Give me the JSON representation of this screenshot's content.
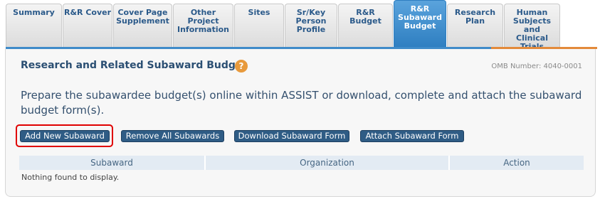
{
  "tabs": [
    {
      "label": "Summary",
      "active": false
    },
    {
      "label": "R&R Cover",
      "active": false
    },
    {
      "label": "Cover Page\nSupplement",
      "active": false
    },
    {
      "label": "Other\nProject\nInformation",
      "active": false
    },
    {
      "label": "Sites",
      "active": false
    },
    {
      "label": "Sr/Key\nPerson\nProfile",
      "active": false
    },
    {
      "label": "R&R Budget",
      "active": false
    },
    {
      "label": "R&R\nSubaward\nBudget",
      "active": true
    },
    {
      "label": "Research\nPlan",
      "active": false
    },
    {
      "label": "Human\nSubjects and\nClinical Trials",
      "active": false
    }
  ],
  "page": {
    "title": "Research and Related Subaward Budget",
    "help_glyph": "?",
    "omb": "OMB Number: 4040-0001",
    "description": "Prepare the subawardee budget(s) online within ASSIST or download, complete and attach the subaward budget form(s)."
  },
  "buttons": {
    "add": "Add New Subaward",
    "remove": "Remove All Subawards",
    "download": "Download Subaward Form",
    "attach": "Attach Subaward Form"
  },
  "table": {
    "columns": [
      "Subaward",
      "Organization",
      "Action"
    ],
    "empty_message": "Nothing found to display."
  }
}
